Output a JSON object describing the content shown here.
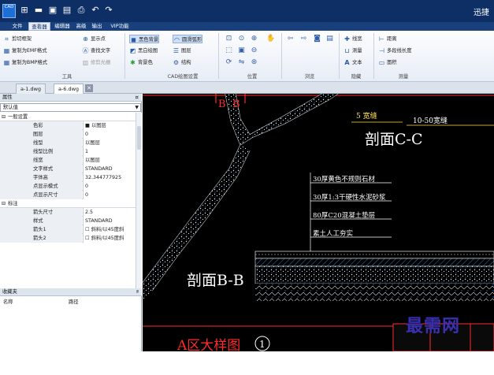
{
  "title_brand": "迅捷",
  "menu": {
    "tabs": [
      "文件",
      "查看器",
      "编辑器",
      "高级",
      "输出",
      "VIP功能"
    ],
    "active": 1
  },
  "ribbon": {
    "tools": {
      "label": "工具",
      "items": [
        "剪切框架",
        "复制为EMF格式",
        "复制为BMP格式",
        "显示点",
        "查找文字",
        "修剪光栅"
      ]
    },
    "cad_settings": {
      "label": "CAD绘图设置",
      "items": [
        "黑色背景",
        "黑白绘图",
        "背景色",
        "圆滑弧形",
        "图层",
        "结构"
      ]
    },
    "position": {
      "label": "位置"
    },
    "browse": {
      "label": "浏览"
    },
    "hide": {
      "label": "隐藏",
      "items": [
        "线宽",
        "测量",
        "文本"
      ]
    },
    "measure": {
      "label": "测量",
      "items": [
        "距离",
        "多段线长度",
        "面积"
      ]
    }
  },
  "doc_tabs": [
    "a-1.dwg",
    "a-6.dwg"
  ],
  "properties_panel": {
    "title": "属性",
    "filter": "默认值",
    "sections": [
      {
        "name": "一般设置",
        "rows": [
          [
            "色彩",
            "■ 以图层"
          ],
          [
            "图层",
            "0"
          ],
          [
            "线型",
            "以图层"
          ],
          [
            "线型比例",
            "1"
          ],
          [
            "线宽",
            "以图层"
          ],
          [
            "文字样式",
            "STANDARD"
          ],
          [
            "字体高",
            "32.344777925"
          ],
          [
            "点显示模式",
            "0"
          ],
          [
            "点显示尺寸",
            "0"
          ]
        ]
      },
      {
        "name": "标注",
        "rows": [
          [
            "箭头尺寸",
            "2.5"
          ],
          [
            "样式",
            "STANDARD"
          ],
          [
            "箭头1",
            "☐ 斜料/以45度斜"
          ],
          [
            "箭头2",
            "☐ 斜料/以45度斜"
          ]
        ]
      }
    ]
  },
  "favorites_panel": {
    "title": "收藏夹",
    "columns": [
      "名称",
      "路径"
    ]
  },
  "drawing": {
    "labels": {
      "b_left": "B",
      "b_right": "B",
      "dim_5": "5 宽缝",
      "dim_10_50": "10-50宽缝",
      "section_cc": "剖面C-C",
      "section_bb": "剖面B-B",
      "layer1": "30厚黄色不规则石材",
      "layer2": "30厚1:3干硬性水泥砂浆",
      "layer3": "80厚C20混凝土垫层",
      "layer4": "素土人工夯实",
      "detail_title": "A区大样图",
      "detail_number": "1"
    }
  },
  "watermark": "最需网",
  "colors": {
    "title_bg": "#0d2f66",
    "menu_bg": "#17407d",
    "cad_red": "#ff2a2a",
    "cad_text": "#ffffff",
    "cad_label": "#ffe14a",
    "hatch": "#e8e8e8",
    "hatch_blue": "#3aa4ff",
    "watermark": "#3a2fae"
  }
}
